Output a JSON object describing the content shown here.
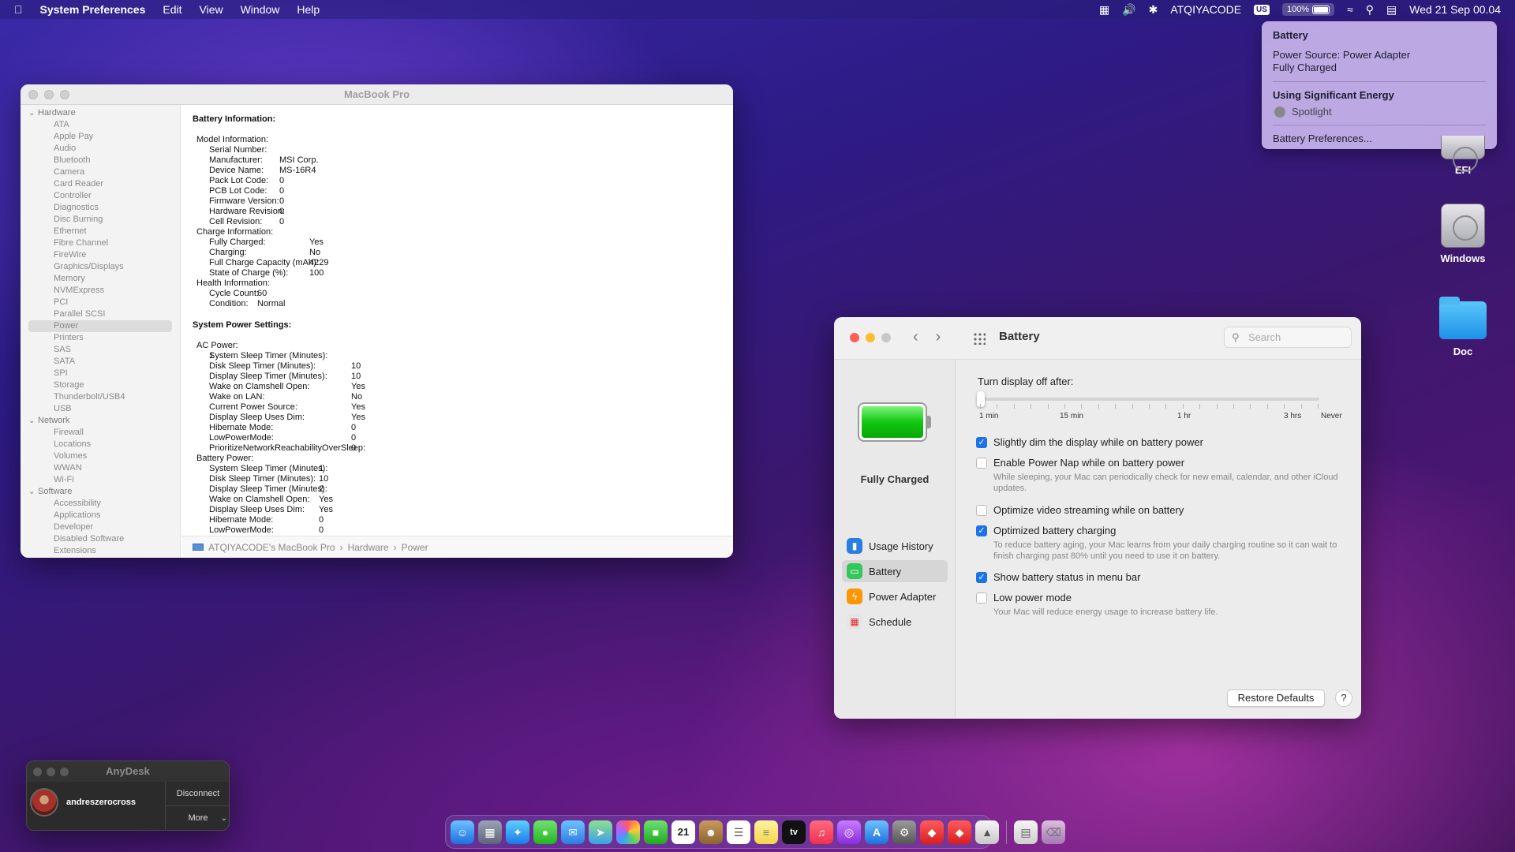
{
  "menubar": {
    "app": "System Preferences",
    "menus": [
      "Edit",
      "View",
      "Window",
      "Help"
    ],
    "user": "ATQIYACODE",
    "input_source": "US",
    "battery_percent": "100%",
    "datetime": "Wed 21 Sep 00.04"
  },
  "battery_menu": {
    "title": "Battery",
    "power_source": "Power Source: Power Adapter",
    "status": "Fully Charged",
    "energy_heading": "Using Significant Energy",
    "energy_app": "Spotlight",
    "prefs_link": "Battery Preferences..."
  },
  "desktop": {
    "icons": [
      "EFI",
      "Windows",
      "Doc"
    ]
  },
  "sysinfo": {
    "title": "MacBook Pro",
    "sidebar": [
      {
        "label": "Hardware",
        "group": true
      },
      {
        "label": "ATA"
      },
      {
        "label": "Apple Pay"
      },
      {
        "label": "Audio"
      },
      {
        "label": "Bluetooth"
      },
      {
        "label": "Camera"
      },
      {
        "label": "Card Reader"
      },
      {
        "label": "Controller"
      },
      {
        "label": "Diagnostics"
      },
      {
        "label": "Disc Burning"
      },
      {
        "label": "Ethernet"
      },
      {
        "label": "Fibre Channel"
      },
      {
        "label": "FireWire"
      },
      {
        "label": "Graphics/Displays"
      },
      {
        "label": "Memory"
      },
      {
        "label": "NVMExpress"
      },
      {
        "label": "PCI"
      },
      {
        "label": "Parallel SCSI"
      },
      {
        "label": "Power",
        "selected": true
      },
      {
        "label": "Printers"
      },
      {
        "label": "SAS"
      },
      {
        "label": "SATA"
      },
      {
        "label": "SPI"
      },
      {
        "label": "Storage"
      },
      {
        "label": "Thunderbolt/USB4"
      },
      {
        "label": "USB"
      },
      {
        "label": "Network",
        "group": true
      },
      {
        "label": "Firewall"
      },
      {
        "label": "Locations"
      },
      {
        "label": "Volumes"
      },
      {
        "label": "WWAN"
      },
      {
        "label": "Wi-Fi"
      },
      {
        "label": "Software",
        "group": true
      },
      {
        "label": "Accessibility"
      },
      {
        "label": "Applications"
      },
      {
        "label": "Developer"
      },
      {
        "label": "Disabled Software"
      },
      {
        "label": "Extensions"
      }
    ],
    "battery_info_heading": "Battery Information:",
    "battery_rows": [
      {
        "i": 1,
        "k": "Model Information:",
        "v": ""
      },
      {
        "i": 2,
        "k": "Serial Number:",
        "v": ""
      },
      {
        "i": 2,
        "k": "Manufacturer:",
        "v": "MSI Corp."
      },
      {
        "i": 2,
        "k": "Device Name:",
        "v": "MS-16R4"
      },
      {
        "i": 2,
        "k": "Pack Lot Code:",
        "v": "0"
      },
      {
        "i": 2,
        "k": "PCB Lot Code:",
        "v": "0"
      },
      {
        "i": 2,
        "k": "Firmware Version:",
        "v": "0"
      },
      {
        "i": 2,
        "k": "Hardware Revision:",
        "v": "0"
      },
      {
        "i": 2,
        "k": "Cell Revision:",
        "v": "0"
      },
      {
        "i": 1,
        "k": "Charge Information:",
        "v": ""
      },
      {
        "i": 2,
        "k": "Fully Charged:",
        "v": "Yes"
      },
      {
        "i": 2,
        "k": "Charging:",
        "v": "No"
      },
      {
        "i": 2,
        "k": "Full Charge Capacity (mAh):",
        "v": "4229"
      },
      {
        "i": 2,
        "k": "State of Charge (%):",
        "v": "100"
      },
      {
        "i": 1,
        "k": "Health Information:",
        "v": ""
      },
      {
        "i": 2,
        "k": "Cycle Count:",
        "v": "60"
      },
      {
        "i": 2,
        "k": "Condition:",
        "v": "Normal"
      }
    ],
    "power_heading": "System Power Settings:",
    "power_rows": [
      {
        "i": 1,
        "k": "AC Power:",
        "v": ""
      },
      {
        "i": 2,
        "k": "System Sleep Timer (Minutes):",
        "v": "1"
      },
      {
        "i": 2,
        "k": "Disk Sleep Timer (Minutes):",
        "v": "10"
      },
      {
        "i": 2,
        "k": "Display Sleep Timer (Minutes):",
        "v": "10"
      },
      {
        "i": 2,
        "k": "Wake on Clamshell Open:",
        "v": "Yes"
      },
      {
        "i": 2,
        "k": "Wake on LAN:",
        "v": "No"
      },
      {
        "i": 2,
        "k": "Current Power Source:",
        "v": "Yes"
      },
      {
        "i": 2,
        "k": "Display Sleep Uses Dim:",
        "v": "Yes"
      },
      {
        "i": 2,
        "k": "Hibernate Mode:",
        "v": "0"
      },
      {
        "i": 2,
        "k": "LowPowerMode:",
        "v": "0"
      },
      {
        "i": 2,
        "k": "PrioritizeNetworkReachabilityOverSleep:",
        "v": "0"
      },
      {
        "i": 1,
        "k": "Battery Power:",
        "v": ""
      },
      {
        "i": 2,
        "k": "System Sleep Timer (Minutes):",
        "v": "1"
      },
      {
        "i": 2,
        "k": "Disk Sleep Timer (Minutes):",
        "v": "10"
      },
      {
        "i": 2,
        "k": "Display Sleep Timer (Minutes):",
        "v": "2"
      },
      {
        "i": 2,
        "k": "Wake on Clamshell Open:",
        "v": "Yes"
      },
      {
        "i": 2,
        "k": "Display Sleep Uses Dim:",
        "v": "Yes"
      },
      {
        "i": 2,
        "k": "Hibernate Mode:",
        "v": "0"
      },
      {
        "i": 2,
        "k": "LowPowerMode:",
        "v": "0"
      }
    ],
    "path": [
      "ATQIYACODE's MacBook Pro",
      "Hardware",
      "Power"
    ]
  },
  "prefs": {
    "title": "Battery",
    "search_placeholder": "Search",
    "status": "Fully Charged",
    "level_fraction": 1.0,
    "nav": [
      {
        "label": "Usage History",
        "color": "#2a7de1",
        "icon": "chart-icon"
      },
      {
        "label": "Battery",
        "color": "#34c759",
        "icon": "battery-icon",
        "selected": true
      },
      {
        "label": "Power Adapter",
        "color": "#ff9500",
        "icon": "bolt-icon"
      },
      {
        "label": "Schedule",
        "color": "#e5e5e5",
        "icon": "calendar-icon"
      }
    ],
    "display_off_label": "Turn display off after:",
    "slider_labels": [
      "1 min",
      "15 min",
      "1 hr",
      "3 hrs",
      "Never"
    ],
    "options": [
      {
        "label": "Slightly dim the display while on battery power",
        "checked": true,
        "desc": ""
      },
      {
        "label": "Enable Power Nap while on battery power",
        "checked": false,
        "desc": "While sleeping, your Mac can periodically check for new email, calendar, and other iCloud updates."
      },
      {
        "label": "Optimize video streaming while on battery",
        "checked": false,
        "desc": ""
      },
      {
        "label": "Optimized battery charging",
        "checked": true,
        "desc": "To reduce battery aging, your Mac learns from your daily charging routine so it can wait to finish charging past 80% until you need to use it on battery."
      },
      {
        "label": "Show battery status in menu bar",
        "checked": true,
        "desc": ""
      },
      {
        "label": "Low power mode",
        "checked": false,
        "desc": "Your Mac will reduce energy usage to increase battery life."
      }
    ],
    "restore_label": "Restore Defaults",
    "help_label": "?"
  },
  "anydesk": {
    "title": "AnyDesk",
    "user": "andreszerocross",
    "disconnect": "Disconnect",
    "more": "More"
  },
  "dock": {
    "calendar_day": "21",
    "tv_label": "tv"
  },
  "colors": {
    "accent": "#1b74e8",
    "close": "#ff5f57",
    "minimize": "#febc2e",
    "zoom": "#c8c8c8"
  }
}
